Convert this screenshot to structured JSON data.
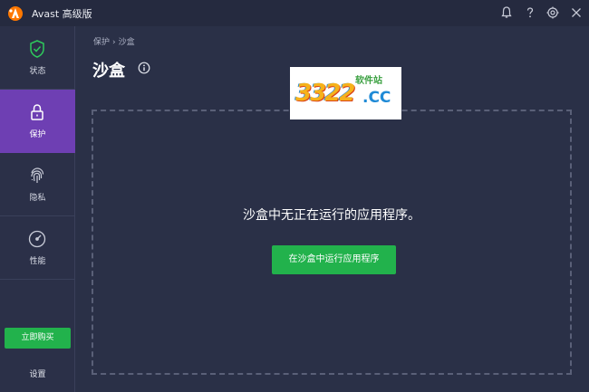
{
  "titlebar": {
    "title": "Avast 高级版",
    "icons": [
      "avast-logo-icon",
      "bell-icon",
      "help-icon",
      "settings-icon",
      "close-icon"
    ]
  },
  "sidebar": {
    "items": [
      {
        "label": "状态",
        "icon": "shield-check-icon",
        "active": false
      },
      {
        "label": "保护",
        "icon": "lock-icon",
        "active": true
      },
      {
        "label": "隐私",
        "icon": "fingerprint-icon",
        "active": false
      },
      {
        "label": "性能",
        "icon": "speedometer-icon",
        "active": false
      }
    ],
    "buy_label": "立即购买",
    "settings_label": "设置"
  },
  "main": {
    "breadcrumb": [
      "保护",
      "沙盒"
    ],
    "breadcrumb_separator": "›",
    "title": "沙盒",
    "empty_message": "沙盒中无正在运行的应用程序。",
    "run_button_label": "在沙盒中运行应用程序"
  },
  "watermark": {
    "digits": "3322",
    "site_label": "软件站",
    "domain": ".CC"
  },
  "colors": {
    "background": "#2a3047",
    "sidebar": "#2b3048",
    "active_nav": "#6e3fb3",
    "accent_green": "#22b24c"
  }
}
